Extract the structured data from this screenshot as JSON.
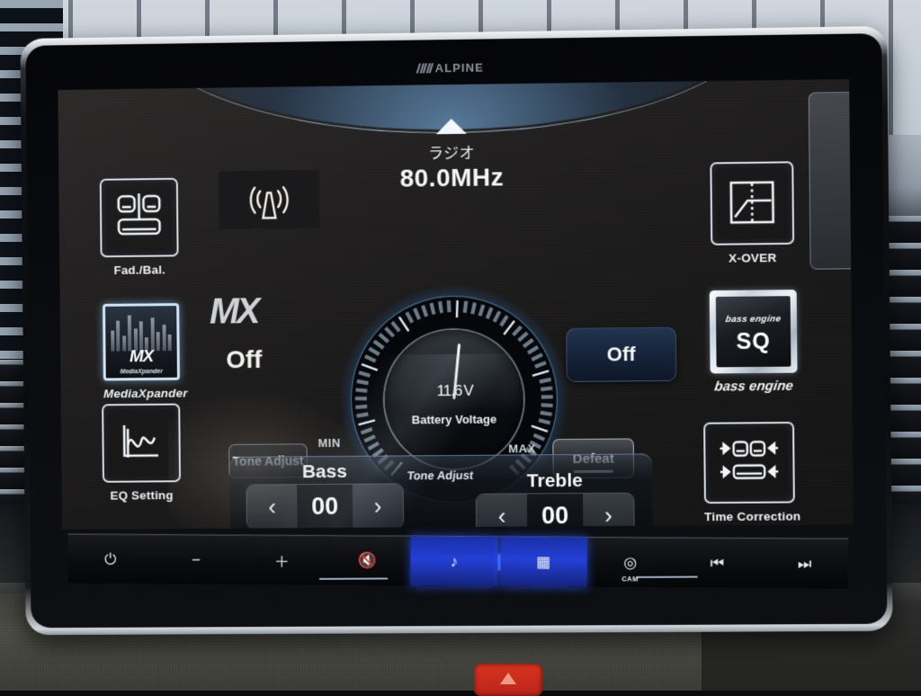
{
  "unit": {
    "brand": "ALPINE",
    "brand_icon": "alpine-slash-logo"
  },
  "header": {
    "source_label": "ラジオ",
    "frequency": "80.0MHz",
    "up_caret_icon": "caret-up-icon"
  },
  "left_tiles": [
    {
      "label": "Fad./Bal.",
      "icon": "fader-balance-seats-icon"
    },
    {
      "label": "MediaXpander",
      "icon": "mediaxpander-thumbnail-icon",
      "logo": "MX",
      "logo_sub": "MediaXpander"
    },
    {
      "label": "EQ Setting",
      "icon": "eq-curve-icon"
    }
  ],
  "right_tiles": [
    {
      "label": "X-OVER",
      "icon": "crossover-graph-icon"
    },
    {
      "label": "bass engine",
      "icon": "bass-engine-sq-icon",
      "inner_word": "bass engine",
      "inner_value": "SQ"
    },
    {
      "label": "Time Correction",
      "icon": "time-correction-seats-icon"
    }
  ],
  "antenna": {
    "icon": "antenna-broadcast-icon"
  },
  "mx_status": {
    "logo": "MX",
    "value": "Off"
  },
  "mode_button": {
    "label": "Off"
  },
  "tone_adjust_button": {
    "label": "Tone Adjust"
  },
  "defeat_button": {
    "label": "Defeat"
  },
  "gauge": {
    "value": "11.6",
    "unit": "V",
    "caption": "Battery Voltage",
    "min_label": "MIN",
    "max_label": "MAX",
    "accent_color": "#64b9ff",
    "tick_color": "#6e7a88"
  },
  "tone_panel": {
    "title": "Tone Adjust",
    "bass": {
      "label": "Bass",
      "value": "00",
      "dec_icon": "chevron-left-icon",
      "inc_icon": "chevron-right-icon"
    },
    "treble": {
      "label": "Treble",
      "value": "00",
      "dec_icon": "chevron-left-icon",
      "inc_icon": "chevron-right-icon"
    }
  },
  "button_bar": [
    {
      "name": "power",
      "glyph": "⏻",
      "icon": "power-icon",
      "lit": false
    },
    {
      "name": "volume-down",
      "glyph": "−",
      "icon": "minus-icon",
      "lit": false
    },
    {
      "name": "volume-up",
      "glyph": "＋",
      "icon": "plus-icon",
      "lit": false
    },
    {
      "name": "mute",
      "glyph": "🔇",
      "icon": "mute-speaker-icon",
      "lit": false
    },
    {
      "name": "audio",
      "glyph": "♪",
      "icon": "music-note-icon",
      "lit": true
    },
    {
      "name": "apps",
      "glyph": "▦",
      "icon": "apps-grid-icon",
      "lit": true
    },
    {
      "name": "camera",
      "glyph": "◎",
      "icon": "camera-icon",
      "lit": false,
      "sublabel": "CAM"
    },
    {
      "name": "previous-track",
      "glyph": "⏮",
      "icon": "previous-track-icon",
      "lit": false
    },
    {
      "name": "next-track",
      "glyph": "⏭",
      "icon": "next-track-icon",
      "lit": false
    }
  ]
}
